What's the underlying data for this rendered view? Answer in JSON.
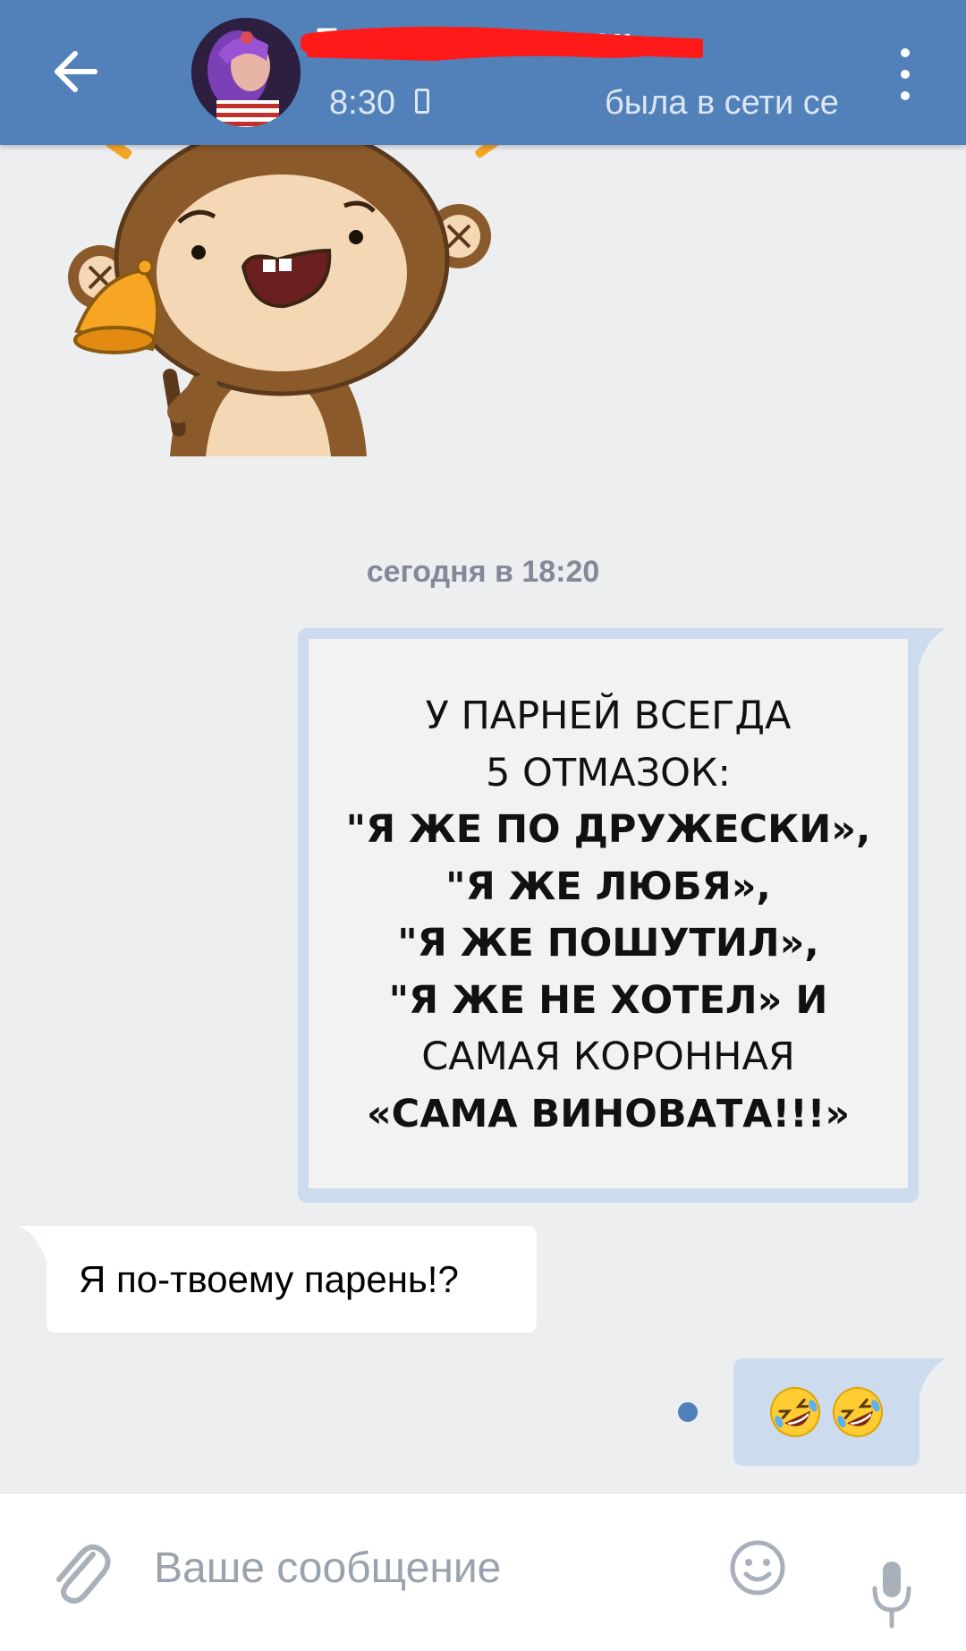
{
  "header": {
    "contact_name": "Евгения Романюк",
    "time": "8:30",
    "status": "была в сети сегодня",
    "avatar": "contact-photo"
  },
  "icons": {
    "back": "arrow-left-icon",
    "menu": "more-vertical-icon",
    "attach": "paperclip-icon",
    "emoji": "smile-icon",
    "mic": "microphone-icon",
    "device": "phone-icon"
  },
  "messages": {
    "sticker": "monkey-with-bell-sticker",
    "date_separator": "сегодня в 18:20",
    "image_text_lines": [
      "У ПАРНЕЙ ВСЕГДА",
      "5 ОТМАЗОК:",
      "\"Я ЖЕ ПО ДРУЖЕСКИ»,",
      "\"Я ЖЕ ЛЮБЯ»,",
      "\"Я ЖЕ ПОШУТИЛ»,",
      "\"Я ЖЕ НЕ ХОТЕЛ» И",
      "САМАЯ КОРОННАЯ",
      "«САМА ВИНОВАТА!!!»"
    ],
    "incoming_text": "Я по-твоему парень!?",
    "outgoing_emoji": "🤣🤣"
  },
  "input": {
    "placeholder": "Ваше сообщение"
  },
  "colors": {
    "header": "#5181b8",
    "background": "#edeef0",
    "outgoing_bubble": "#ccdcee",
    "incoming_bubble": "#ffffff",
    "unread_dot": "#5181b8"
  }
}
